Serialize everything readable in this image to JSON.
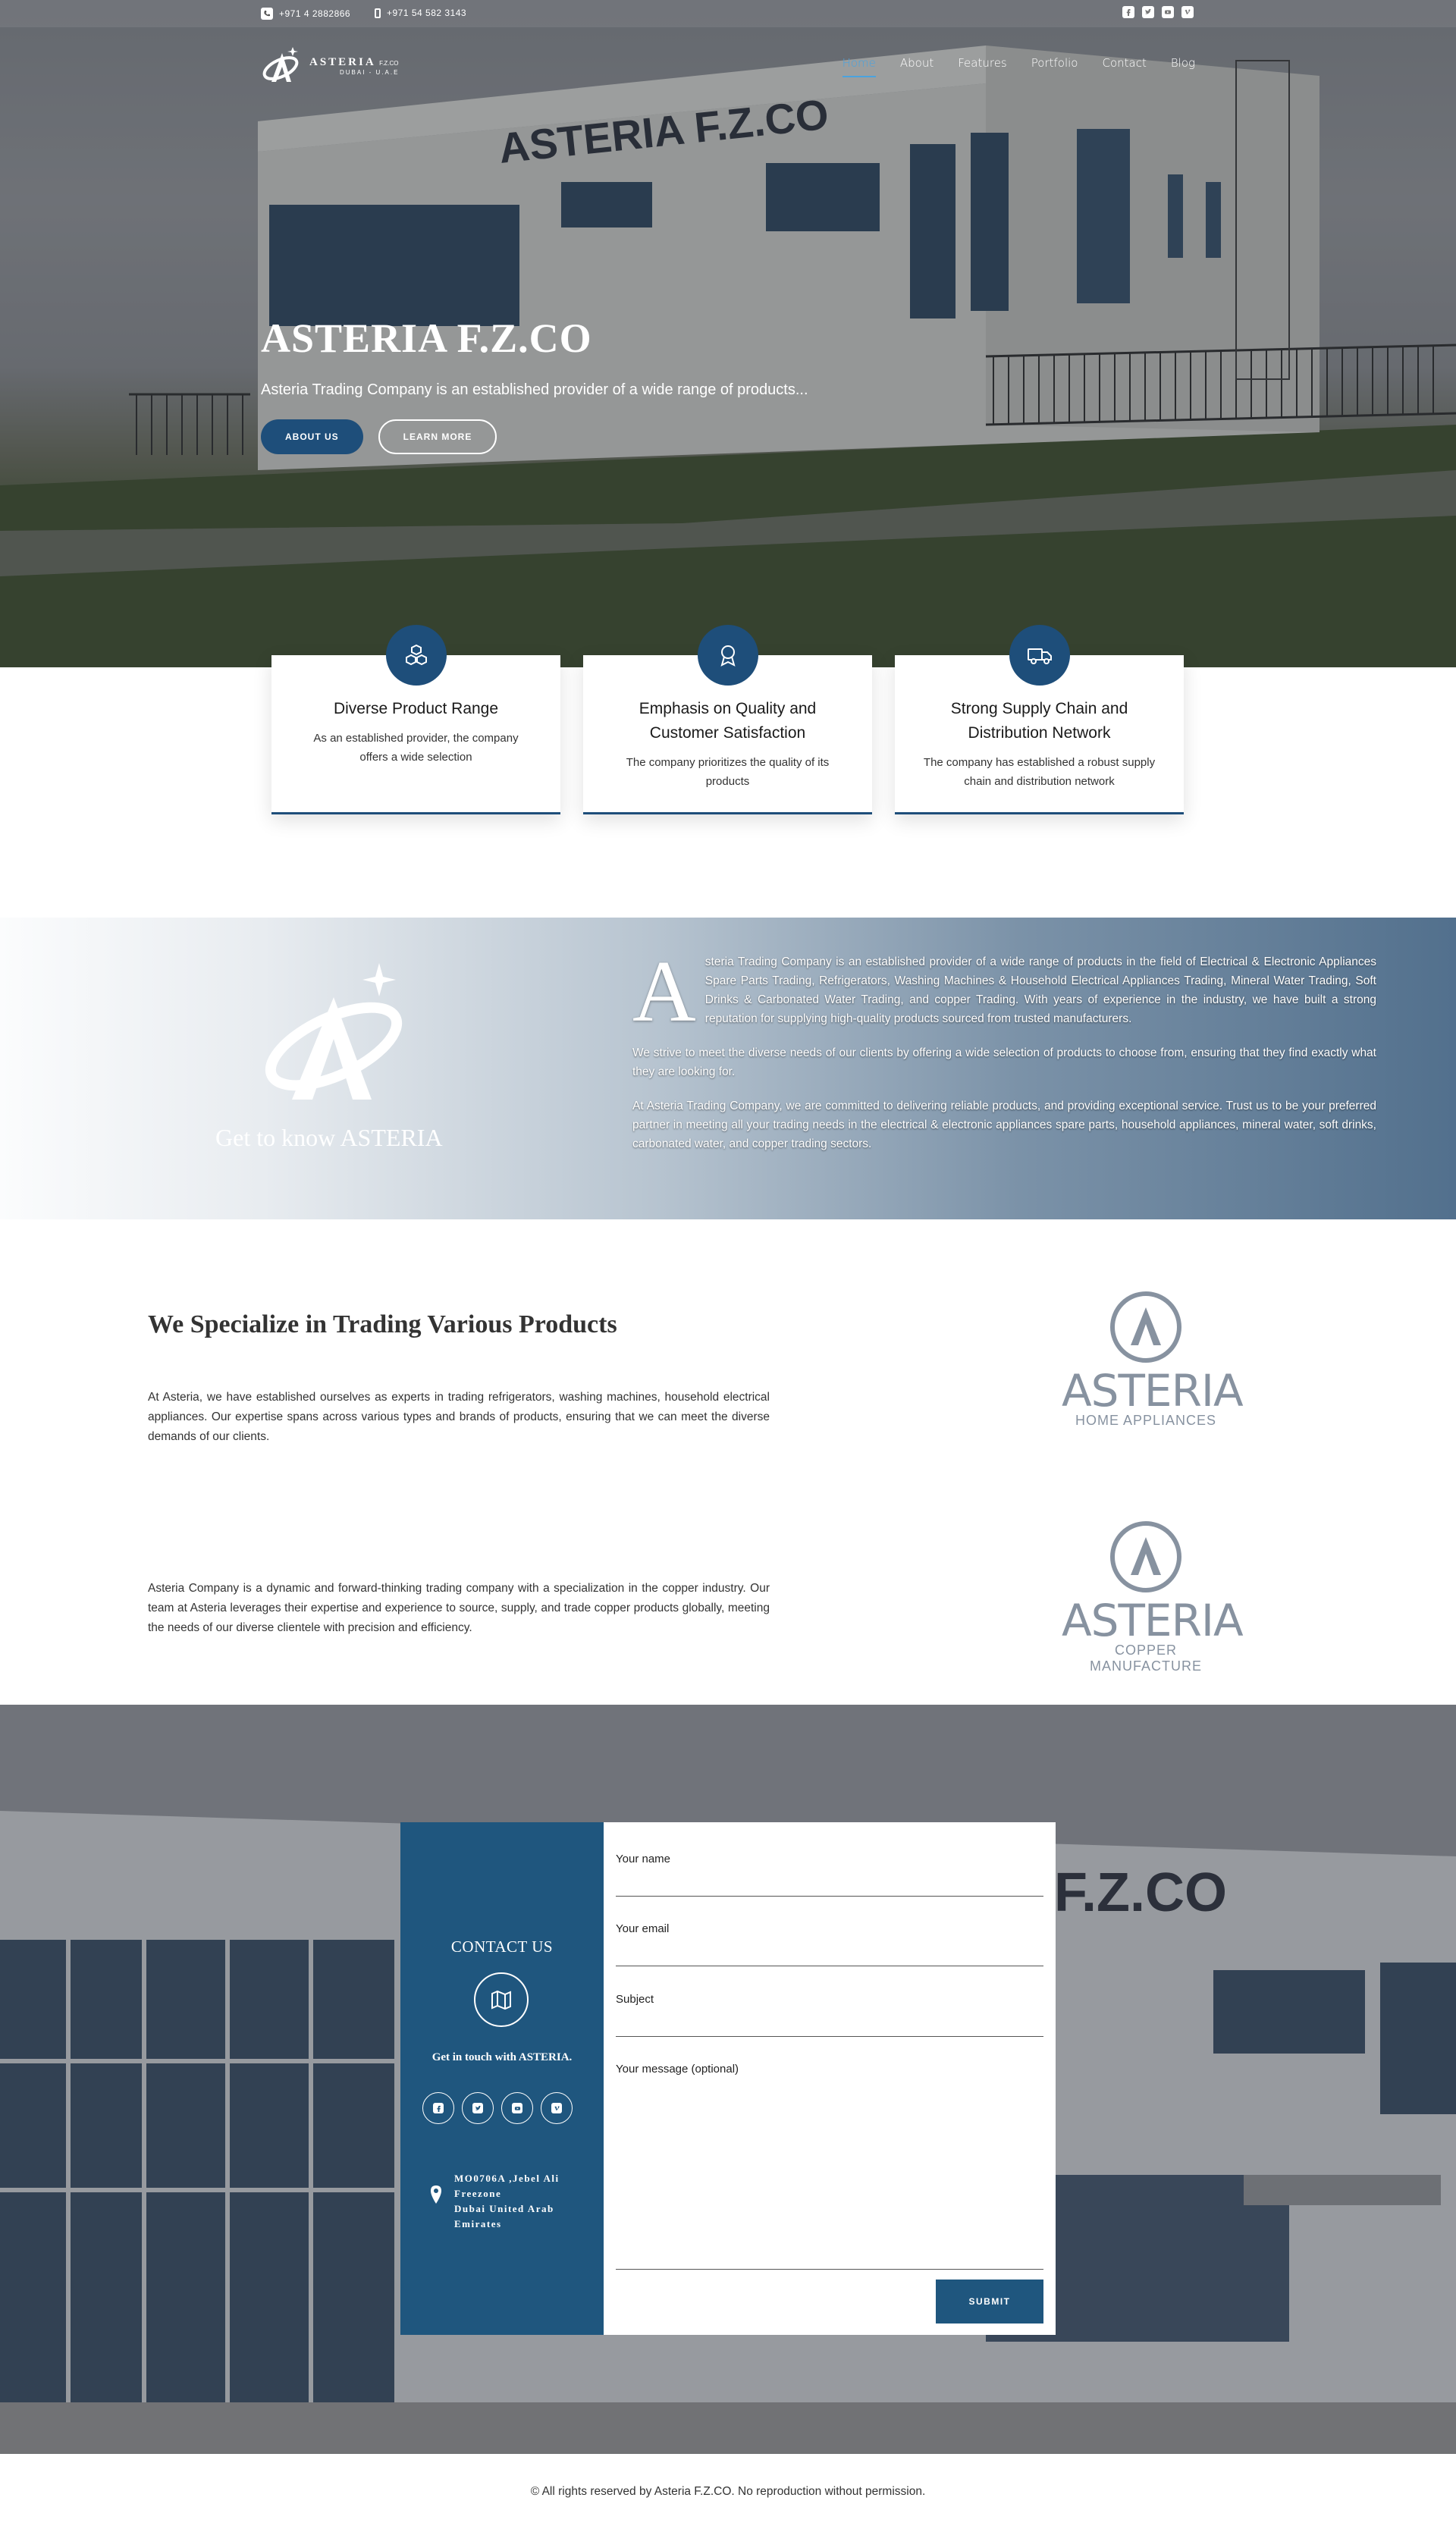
{
  "topbar": {
    "phone1": "+971 4 2882866",
    "phone2": "+971 54 582 3143",
    "social_icons": [
      "facebook-icon",
      "twitter-icon",
      "youtube-icon",
      "vimeo-icon"
    ]
  },
  "logo": {
    "brand": "ASTERIA",
    "suffix": "F.Z.CO",
    "sub": "DUBAI - U.A.E"
  },
  "nav": {
    "items": [
      "Home",
      "About",
      "Features",
      "Portfolio",
      "Contact",
      "Blog"
    ],
    "active": "Home",
    "active_color": "#4aa3df"
  },
  "hero": {
    "title": "ASTERIA F.Z.CO",
    "subtitle": "Asteria Trading Company is an established provider of a wide range of products...",
    "btn_about": "ABOUT US",
    "btn_learn": "LEARN MORE",
    "building_sign": "ASTERIA F.Z.CO"
  },
  "features": [
    {
      "icon": "boxes-icon",
      "title": "Diverse Product Range",
      "text": "As an established provider, the company offers a wide selection"
    },
    {
      "icon": "award-ribbon-icon",
      "title": "Emphasis on Quality and Customer Satisfaction",
      "text": "The company prioritizes the quality of its products"
    },
    {
      "icon": "truck-icon",
      "title": "Strong Supply Chain and Distribution Network",
      "text": "The company has established a robust supply chain and distribution network"
    }
  ],
  "about": {
    "heading": "Get to know ASTERIA",
    "dropcap": "A",
    "p1": "steria Trading Company is an established provider of a wide range of products in the field of Electrical & Electronic Appliances Spare Parts Trading, Refrigerators, Washing Machines & Household Electrical Appliances Trading, Mineral Water Trading, Soft Drinks & Carbonated Water Trading, and copper Trading. With years of experience in the industry, we have built a strong reputation for supplying high-quality products sourced from trusted manufacturers.",
    "p2": "We strive to meet the diverse needs of our clients by offering a wide selection of products to choose from, ensuring that they find exactly what they are looking for.",
    "p3": "At Asteria Trading Company, we are committed to  delivering reliable products, and providing exceptional service. Trust us to be your preferred partner in meeting all your trading needs in the electrical & electronic appliances spare parts, household appliances, mineral water, soft drinks, carbonated water, and copper trading sectors."
  },
  "specialize": {
    "title": "We Specialize in Trading Various Products",
    "p1": "At Asteria, we have established ourselves as experts in trading refrigerators, washing machines, household electrical appliances. Our expertise spans across various types and brands of products, ensuring that we can meet the diverse demands of our clients.",
    "p2": "Asteria Company is a dynamic and forward-thinking trading company with a specialization in the copper industry. Our team at Asteria leverages their expertise and experience to source, supply, and trade copper products globally, meeting the needs of our diverse clientele with precision and efficiency.",
    "logo1_name": "ASTERIA",
    "logo1_sub": "HOME APPLIANCES",
    "logo2_name": "ASTERIA",
    "logo2_sub": "COPPER MANUFACTURE"
  },
  "contact": {
    "title": "CONTACT US",
    "tagline": "Get in touch with ASTERIA.",
    "address": [
      "MO0706A ,Jebel Ali",
      "Freezone",
      "Dubai United Arab",
      "Emirates"
    ],
    "fields": {
      "name": "Your name",
      "email": "Your email",
      "subject": "Subject",
      "message": "Your message (optional)"
    },
    "submit": "SUBMIT",
    "accent": "#1f567e",
    "building_sign": "F.Z.CO"
  },
  "footer": {
    "text": "© All rights reserved by Asteria F.Z.CO. No reproduction without permission."
  }
}
